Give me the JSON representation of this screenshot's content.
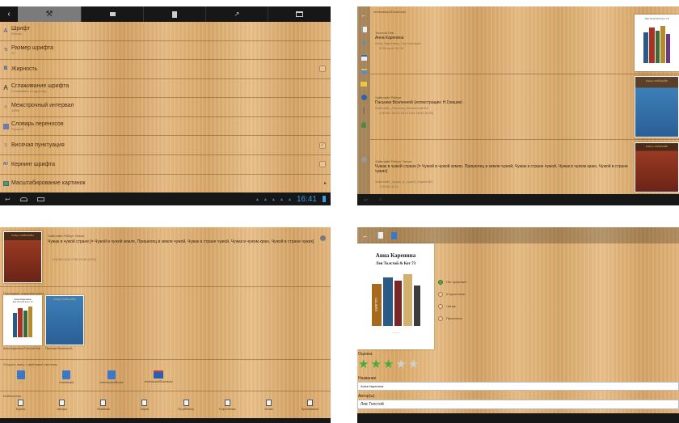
{
  "p1": {
    "settings": [
      {
        "title": "Шрифт",
        "sub": "Roboto",
        "ctl": ""
      },
      {
        "title": "Размер шрифта",
        "sub": "22",
        "ctl": ""
      },
      {
        "title": "Жирность",
        "sub": "",
        "ctl": "box"
      },
      {
        "title": "Сглаживание шрифта",
        "sub": "Сглаживать по-другому",
        "ctl": ""
      },
      {
        "title": "Межстрочный интервал",
        "sub": "100%",
        "ctl": ""
      },
      {
        "title": "Словарь переносов",
        "sub": "Русский",
        "ctl": ""
      },
      {
        "title": "Висячая пунктуация",
        "sub": "",
        "ctl": "check"
      },
      {
        "title": "Кернинг шрифта",
        "sub": "",
        "ctl": "box"
      },
      {
        "title": "Масштабирование картинок",
        "sub": "",
        "ctl": "arrow"
      }
    ],
    "time": "16:41"
  },
  "p2": {
    "path": "/mnt/sdcard/Download",
    "books": [
      {
        "author": "Толстой Лев",
        "title": "Анна Каренина",
        "details": "Анна_Каренина_Толстой.epub",
        "meta": "9758 epub 14.04",
        "cover_title": "Лев Толстой & Кот 73"
      },
      {
        "author": "Хайнлайн Роберт",
        "title": "Пасынки Вселенной (иллюстрации: Н.Гришин)",
        "details": "Хайнлайн_Пасынки_Вселенной.fb2",
        "meta": "1.98 fb2 26.02.2013 0:54 16.62 (0:00)",
        "cover_title": "Роберт ХАЙНЛАЙН"
      },
      {
        "author": "Хайнлайн Роберт Энсон",
        "title": "Чужак в чужой стране [= Чужой в чужой земле, Пришелец в земле чужой, Чужак в стране чужой, Чужак в чужом краю, Чужой в стране чужих]",
        "details": "Хайнлайн_Чужак_в_чужой_стране.fb2",
        "meta": "1.39 fb2 8.04",
        "cover_title": "Роберт ХАЙНЛАЙН"
      }
    ]
  },
  "p3": {
    "current_author": "Хайнлайн Роберт Энсон",
    "current_title": "Чужак в чужой стране [= Чужой в чужой земле, Пришелец в земле чужой, Чужак в стране чужой, Чужак в чужом краю, Чужой в стране чужих]",
    "current_meta": "1.98 fb2 8.04 0.95 16.40 (0.00)",
    "current_cover": "Роберт ХАЙНЛАЙН",
    "recent_label": "Последние открытые книги",
    "recent": [
      {
        "caption": "Анна Каренина Толстой Лев",
        "cover_title": "Анна Каренина",
        "cover_sub": "Лев Толстой & Кот 73"
      },
      {
        "caption": "Пасынки Вселенной...",
        "cover_title": "Роберт ХАЙНЛАЙН",
        "cover_sub": ""
      }
    ],
    "fs_label": "Открыть книгу с файловой системы",
    "dirs": [
      "/",
      "/mnt/sdcard",
      "/mnt/sdcard/Books",
      "/mnt/sdcard/Download"
    ],
    "lib_label": "Библиотека",
    "lib": [
      "Корень",
      "Авторы",
      "Названия",
      "Серии",
      "По рейтингу",
      "К прочтению",
      "Читаю",
      "Прочитанное"
    ]
  },
  "p4": {
    "cover_title": "Анна Каренина",
    "cover_author": "Лев Толстой & Кот 73",
    "cover_spine": "CALIBRE",
    "status": [
      "Нет признака",
      "К прочтению",
      "Читаю",
      "Прочитано"
    ],
    "status_selected": 0,
    "rating_label": "Оценка",
    "rating": 3,
    "rating_max": 5,
    "name_label": "Название",
    "name_value": "Анна Каренина",
    "author_label": "Автор(ы)",
    "author_value": "Лев Толстой"
  }
}
